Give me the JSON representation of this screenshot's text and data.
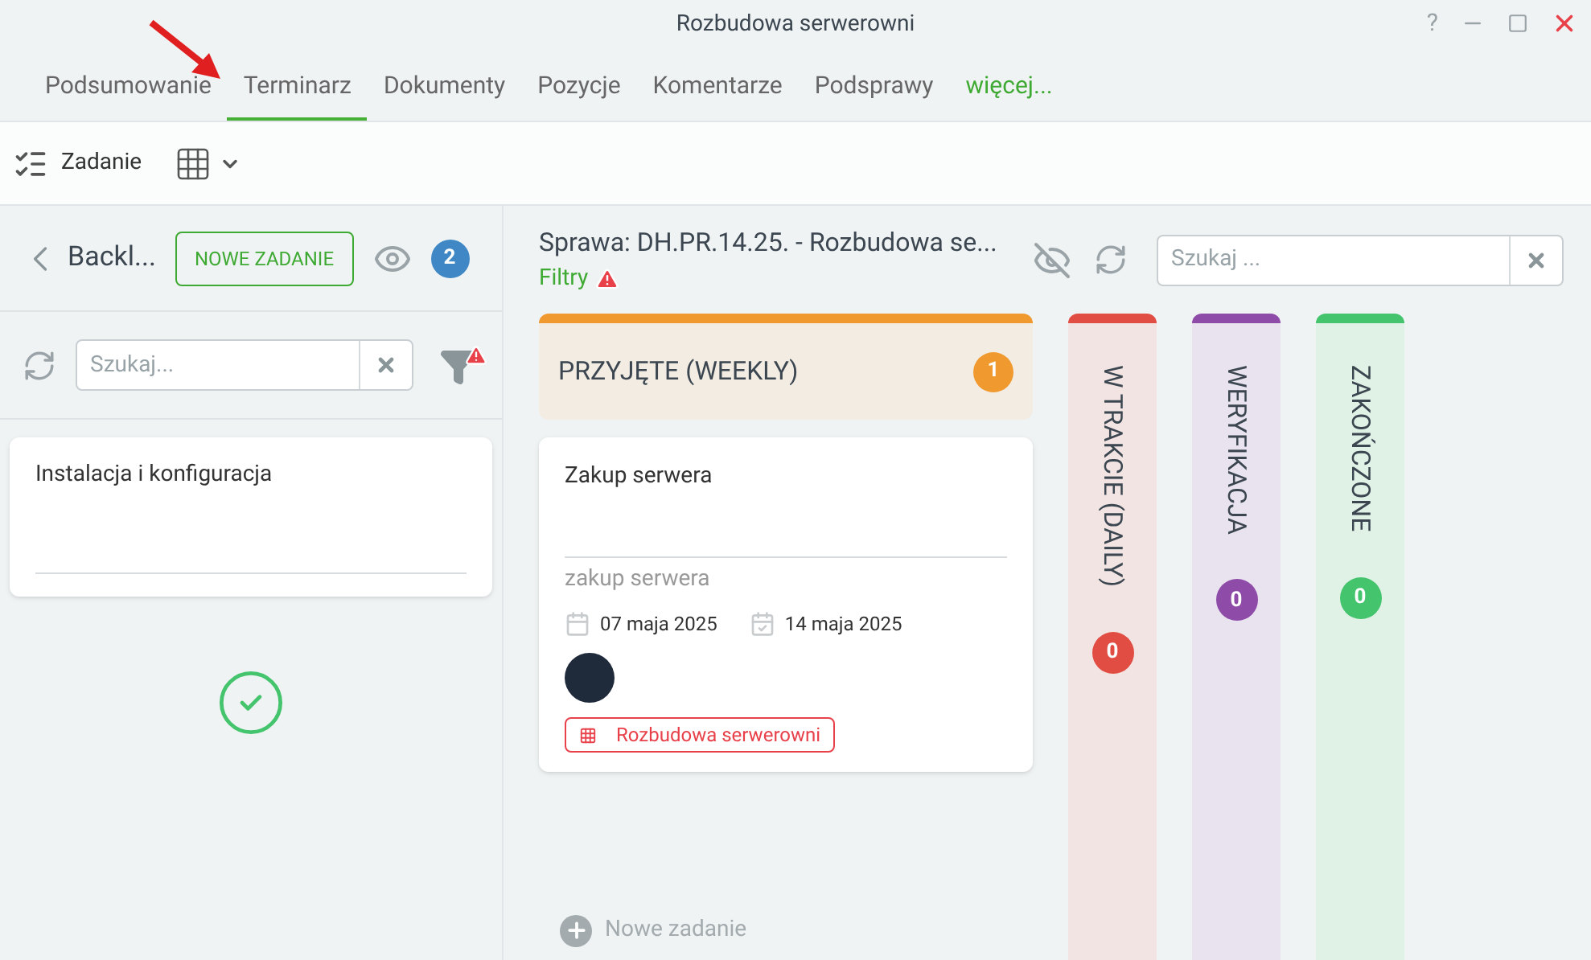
{
  "window": {
    "title": "Rozbudowa serwerowni",
    "controls": [
      "?"
    ]
  },
  "tabs": [
    {
      "label": "Podsumowanie",
      "selected": false,
      "kind": "tab"
    },
    {
      "label": "Terminarz",
      "selected": true,
      "kind": "tab"
    },
    {
      "label": "Dokumenty",
      "selected": false,
      "kind": "tab"
    },
    {
      "label": "Pozycje",
      "selected": false,
      "kind": "tab"
    },
    {
      "label": "Komentarze",
      "selected": false,
      "kind": "tab"
    },
    {
      "label": "Podsprawy",
      "selected": false,
      "kind": "tab"
    },
    {
      "label": "więcej...",
      "selected": false,
      "kind": "more"
    }
  ],
  "toolbar": {
    "task_button": "Zadanie"
  },
  "backlog": {
    "title": "Backl...",
    "new_button": "NOWE ZADANIE",
    "count": "2",
    "search": {
      "placeholder": "Szukaj..."
    },
    "cards": [
      {
        "title": "Instalacja i konfiguracja"
      }
    ]
  },
  "board": {
    "case_title": "Sprawa: DH.PR.14.25. - Rozbudowa se...",
    "filters": "Filtry",
    "search": {
      "placeholder": "Szukaj ..."
    },
    "columns": [
      {
        "title": "PRZYJĘTE (WEEKLY)",
        "count": "1",
        "color": "#f0992e",
        "expanded": true,
        "cards": [
          {
            "title": "Zakup serwera",
            "description": "zakup serwera",
            "start": "07 maja 2025",
            "end": "14 maja 2025",
            "tag": "Rozbudowa serwerowni"
          }
        ],
        "add": "Nowe zadanie"
      },
      {
        "title": "W TRAKCIE (DAILY)",
        "count": "0",
        "color": "#e14d43",
        "expanded": false
      },
      {
        "title": "WERYFIKACJA",
        "count": "0",
        "color": "#8e4ba8",
        "expanded": false
      },
      {
        "title": "ZAKOŃCZONE",
        "count": "0",
        "color": "#45c46e",
        "expanded": false
      }
    ]
  }
}
